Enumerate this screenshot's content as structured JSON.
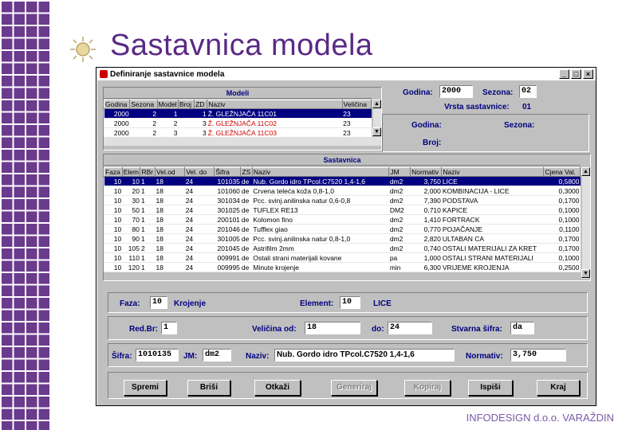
{
  "slide": {
    "title": "Sastavnica modela",
    "footer": "INFODESIGN d.o.o. VARAŽDIN"
  },
  "window": {
    "title": "Definiranje sastavnice modela",
    "controls": [
      "_",
      "□",
      "×"
    ]
  },
  "modeli": {
    "heading": "Modeli",
    "columns": [
      "Godina",
      "Sezona",
      "Model",
      "Broj",
      "ZD",
      "Naziv",
      "Veličina"
    ],
    "rows": [
      {
        "godina": "2000",
        "sezona": "2",
        "model": "1",
        "zd": "1",
        "naziv": "Ž. GLEŽNJAČA 11C01",
        "velicina": "23",
        "selected": true
      },
      {
        "godina": "2000",
        "sezona": "2",
        "model": "2",
        "zd": "3",
        "naziv": "Ž. GLEŽNJAČA 11C02",
        "velicina": "23",
        "selected": false
      },
      {
        "godina": "2000",
        "sezona": "2",
        "model": "3",
        "zd": "3",
        "naziv": "Ž. GLEŽNJAČA 11C03",
        "velicina": "23",
        "selected": false
      }
    ]
  },
  "header_fields": {
    "godina_label": "Godina:",
    "godina_value": "2000",
    "sezona_label": "Sezona:",
    "sezona_value": "02",
    "vrsta_label": "Vrsta sastavnice:",
    "vrsta_value": "01",
    "godina2_label": "Godina:",
    "sezona2_label": "Sezona:",
    "broj_label": "Broj:"
  },
  "sastavnica": {
    "heading": "Sastavnica",
    "columns": [
      "Faza",
      "Elem",
      "RBr",
      "Vel.od",
      "Vel. do",
      "Šifra",
      "ZS",
      "Naziv",
      "JM",
      "Normativ",
      "Naziv",
      "Cjena Val."
    ],
    "rows": [
      {
        "faza": "10",
        "elem": "10",
        "rbr": "1",
        "vod": "18",
        "vdo": "24",
        "sifra": "101035",
        "zs": "de",
        "naziv": "Nub. Gordo idro TPcol.C7520 1,4-1,6",
        "jm": "dm2",
        "norm": "3,750",
        "naziv2": "LICE",
        "cijena": "0,5800",
        "selected": true
      },
      {
        "faza": "10",
        "elem": "20",
        "rbr": "1",
        "vod": "18",
        "vdo": "24",
        "sifra": "101060",
        "zs": "de",
        "naziv": "Crvena teleća koža 0,8-1,0",
        "jm": "dm2",
        "norm": "2,000",
        "naziv2": "KOMBINACIJA - LICE",
        "cijena": "0,3000",
        "selected": false
      },
      {
        "faza": "10",
        "elem": "30",
        "rbr": "1",
        "vod": "18",
        "vdo": "24",
        "sifra": "301034",
        "zs": "de",
        "naziv": "Pcc. svinj.anilinska natur 0,6-0,8",
        "jm": "dm2",
        "norm": "7,390",
        "naziv2": "PODSTAVA",
        "cijena": "0,1700",
        "selected": false
      },
      {
        "faza": "10",
        "elem": "50",
        "rbr": "1",
        "vod": "18",
        "vdo": "24",
        "sifra": "301025",
        "zs": "de",
        "naziv": "TUFLEX RE13",
        "jm": "DM2",
        "norm": "0,710",
        "naziv2": "KAPICE",
        "cijena": "0,1000",
        "selected": false
      },
      {
        "faza": "10",
        "elem": "70",
        "rbr": "1",
        "vod": "18",
        "vdo": "24",
        "sifra": "200101",
        "zs": "de",
        "naziv": "Kolomon fino",
        "jm": "dm2",
        "norm": "1,410",
        "naziv2": "FORTRACK",
        "cijena": "0,1000",
        "selected": false
      },
      {
        "faza": "10",
        "elem": "80",
        "rbr": "1",
        "vod": "18",
        "vdo": "24",
        "sifra": "201046",
        "zs": "de",
        "naziv": "Tufflex giao",
        "jm": "dm2",
        "norm": "0,770",
        "naziv2": "POJAČANJE",
        "cijena": "0,1100",
        "selected": false
      },
      {
        "faza": "10",
        "elem": "90",
        "rbr": "1",
        "vod": "18",
        "vdo": "24",
        "sifra": "301005",
        "zs": "de",
        "naziv": "Pcc. svinj.anilinska natur 0,8-1,0",
        "jm": "dm2",
        "norm": "2,820",
        "naziv2": "ULTABAN CA",
        "cijena": "0,1700",
        "selected": false
      },
      {
        "faza": "10",
        "elem": "105",
        "rbr": "2",
        "vod": "18",
        "vdo": "24",
        "sifra": "201045",
        "zs": "de",
        "naziv": "Astrifilm 2mm",
        "jm": "dm2",
        "norm": "0,740",
        "naziv2": "OSTALI MATERIJALI ZA KRET",
        "cijena": "0,1700",
        "selected": false
      },
      {
        "faza": "10",
        "elem": "110",
        "rbr": "1",
        "vod": "18",
        "vdo": "24",
        "sifra": "009991",
        "zs": "de",
        "naziv": "Ostali strani materijali kovane",
        "jm": "pa",
        "norm": "1,000",
        "naziv2": "OSTALI STRANI MATERIJALI",
        "cijena": "0,1000",
        "selected": false
      },
      {
        "faza": "10",
        "elem": "120",
        "rbr": "1",
        "vod": "18",
        "vdo": "24",
        "sifra": "009995",
        "zs": "de",
        "naziv": "Minute krojenje",
        "jm": "min",
        "norm": "6,300",
        "naziv2": "VRIJEME KROJENJA",
        "cijena": "0,2500",
        "selected": false
      }
    ]
  },
  "detail": {
    "faza_label": "Faza:",
    "faza_value": "10",
    "faza_text": "Krojenje",
    "element_label": "Element:",
    "element_value": "10",
    "element_text": "LICE",
    "rbr_label": "Red.Br:",
    "rbr_value": "1",
    "velod_label": "Veličina od:",
    "velod_value": "18",
    "veldo_label": "do:",
    "veldo_value": "24",
    "stvarna_label": "Stvarna šifra:",
    "stvarna_value": "da",
    "sifra_label": "Šifra:",
    "sifra_value": "1010135",
    "jm_label": "JM:",
    "jm_value": "dm2",
    "naziv_label": "Naziv:",
    "naziv_value": "Nub. Gordo idro TPcol.C7520 1,4-1,6",
    "normativ_label": "Normativ:",
    "normativ_value": "3,750"
  },
  "buttons": {
    "spremi": "Spremi",
    "brisi": "Briši",
    "otkazi": "Otkaži",
    "generiraj": "Generiraj",
    "kopiraj": "Kopiraj",
    "ispisi": "Ispiši",
    "kraj": "Kraj"
  }
}
